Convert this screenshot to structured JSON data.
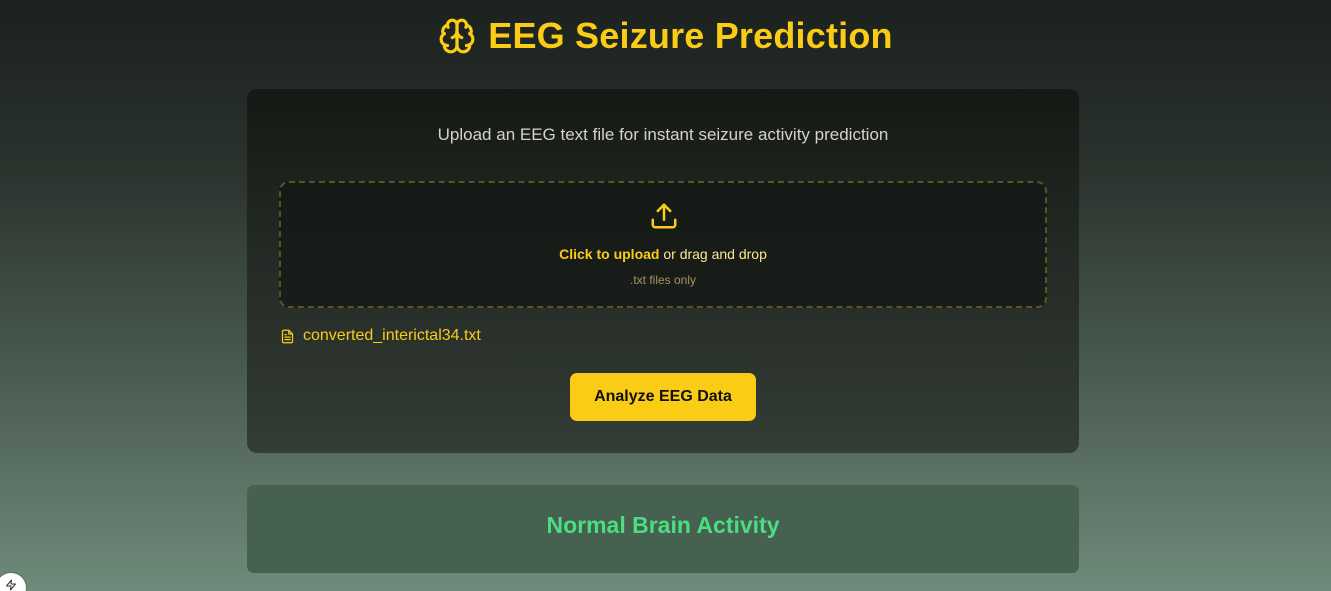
{
  "header": {
    "title": "EEG Seizure Prediction",
    "icon": "brain-icon"
  },
  "upload_card": {
    "subtitle": "Upload an EEG text file for instant seizure activity prediction",
    "dropzone": {
      "icon": "upload-icon",
      "click_label": "Click to upload",
      "drag_label": " or drag and drop",
      "hint": ".txt files only"
    },
    "selected_file": {
      "icon": "file-text-icon",
      "name": "converted_interictal34.txt"
    },
    "analyze_label": "Analyze EEG Data"
  },
  "result": {
    "label": "Normal Brain Activity"
  },
  "colors": {
    "accent": "#facc15",
    "result_text": "#4ade80",
    "result_bg": "#466150"
  },
  "corner_badge": {
    "icon": "bolt-icon"
  }
}
